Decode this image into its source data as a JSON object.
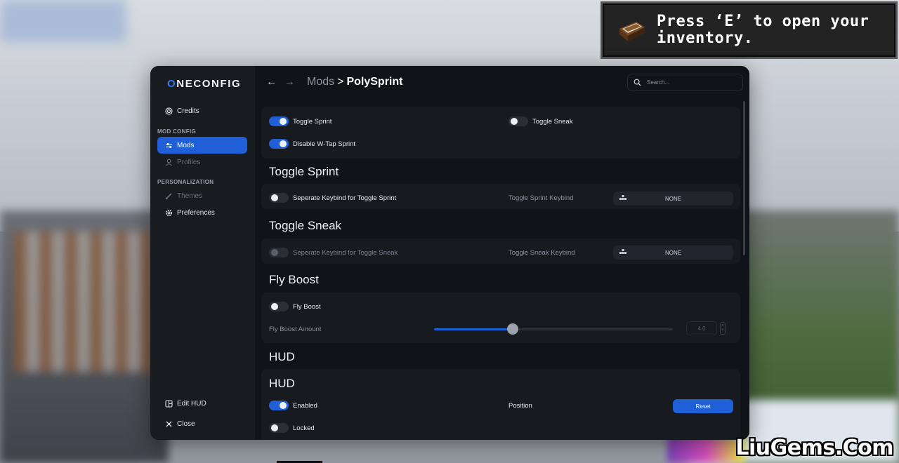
{
  "toast": {
    "message": "Press ‘E’ to open your\ninventory."
  },
  "watermark": "LiuGems.Com",
  "app": {
    "logo_prefix": "O",
    "logo_rest": "NECONFIG"
  },
  "sidebar": {
    "credits": "Credits",
    "section_mod_config": "MOD CONFIG",
    "mods": "Mods",
    "profiles": "Profiles",
    "section_personalization": "PERSONALIZATION",
    "themes": "Themes",
    "preferences": "Preferences",
    "edit_hud": "Edit HUD",
    "close": "Close"
  },
  "header": {
    "back_icon": "←",
    "forward_icon": "→",
    "breadcrumb_parent": "Mods",
    "breadcrumb_sep": ">",
    "breadcrumb_current": "PolySprint",
    "search_placeholder": "Search..."
  },
  "general": {
    "toggle_sprint": {
      "label": "Toggle Sprint",
      "on": true
    },
    "toggle_sneak": {
      "label": "Toggle Sneak",
      "on": false
    },
    "disable_wtap": {
      "label": "Disable W-Tap Sprint",
      "on": true
    }
  },
  "toggle_sprint_section": {
    "heading": "Toggle Sprint",
    "separate_keybind": {
      "label": "Seperate Keybind for Toggle Sprint",
      "on": false
    },
    "keybind_label": "Toggle Sprint Keybind",
    "keybind_value": "NONE"
  },
  "toggle_sneak_section": {
    "heading": "Toggle Sneak",
    "separate_keybind": {
      "label": "Seperate Keybind for Toggle Sneak",
      "on": false,
      "disabled": true
    },
    "keybind_label": "Toggle Sneak Keybind",
    "keybind_value": "NONE"
  },
  "fly_boost_section": {
    "heading": "Fly Boost",
    "fly_boost": {
      "label": "Fly Boost",
      "on": false
    },
    "amount_label": "Fly Boost Amount",
    "amount_value": "4.0",
    "slider_fraction": 0.33
  },
  "hud_section": {
    "heading": "HUD",
    "card_heading": "HUD",
    "enabled": {
      "label": "Enabled",
      "on": true
    },
    "position_label": "Position",
    "reset_label": "Reset",
    "locked": {
      "label": "Locked",
      "on": false
    }
  },
  "colors": {
    "accent": "#1f5fd8",
    "panel": "#101318",
    "sidebar": "#181b20",
    "card": "#171a1f"
  }
}
